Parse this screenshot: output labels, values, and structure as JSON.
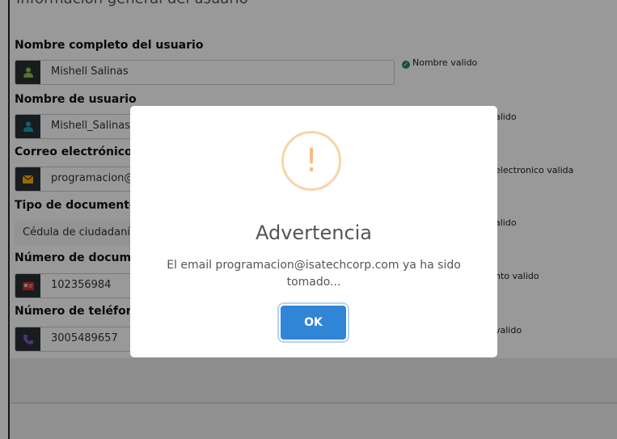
{
  "section_title": "Información general del usuario",
  "fields": {
    "full_name": {
      "label": "Nombre completo del usuario",
      "value": "Mishell Salinas",
      "valid": "Nombre valido",
      "icon": "user-icon"
    },
    "username": {
      "label": "Nombre de usuario",
      "value": "Mishell_Salinas",
      "valid": "alido",
      "icon": "user-icon"
    },
    "email": {
      "label": "Correo electrónico",
      "value": "programacion@",
      "valid": "electronico valida",
      "icon": "envelope-icon"
    },
    "doc_type": {
      "label": "Tipo de documento",
      "value": "Cédula de ciudadanía",
      "valid": "alido"
    },
    "doc_number": {
      "label": "Número de document",
      "value": "102356984",
      "valid": "nto valido",
      "icon": "id-card-icon"
    },
    "phone": {
      "label": "Número de teléfono",
      "value": "3005489657",
      "valid": "valido",
      "icon": "phone-icon"
    }
  },
  "modal": {
    "icon_glyph": "!",
    "title": "Advertencia",
    "message": "El email programacion@isatechcorp.com ya ha sido tomado...",
    "ok_label": "OK"
  },
  "colors": {
    "accent": "#3085d6",
    "warning": "#f8bb86",
    "success": "#1e8c5b"
  }
}
